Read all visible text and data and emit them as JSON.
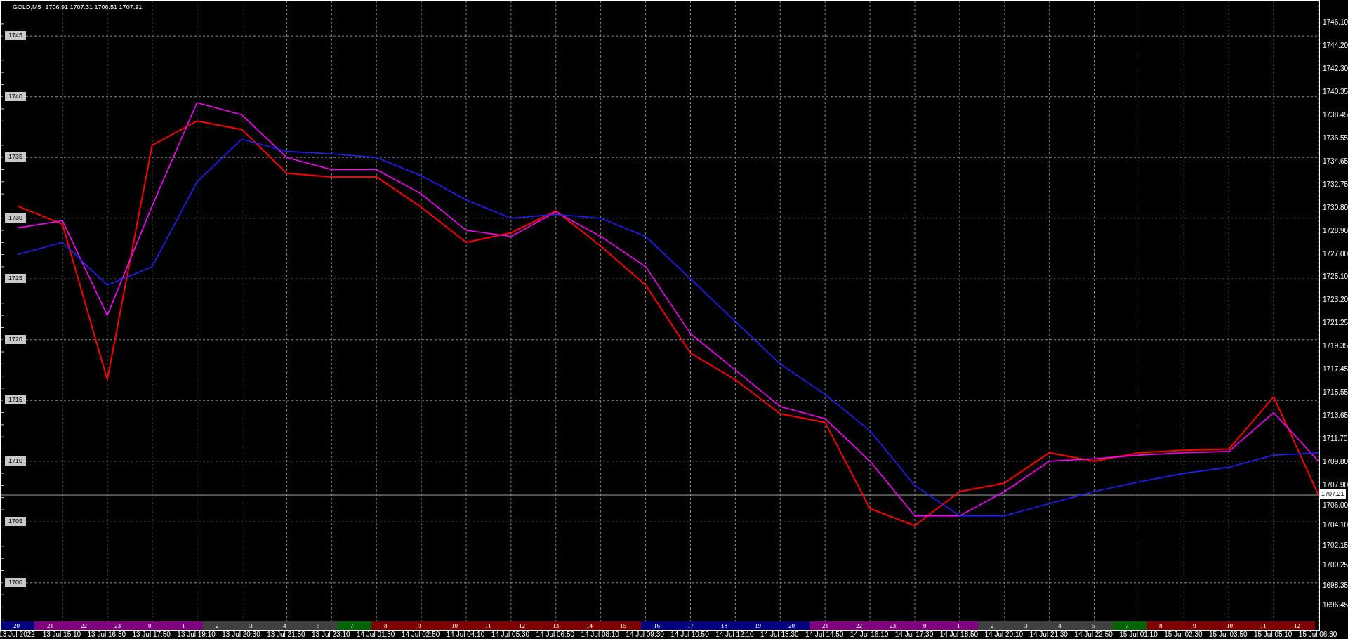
{
  "header": {
    "symbol": "GOLD,M5",
    "quote": "1706.91 1707.31 1706.51 1707.21"
  },
  "chart_data": {
    "type": "line",
    "x": [
      "13 Jul 2022",
      "13 Jul 15:10",
      "13 Jul 16:30",
      "13 Jul 17:50",
      "13 Jul 19:10",
      "13 Jul 20:30",
      "13 Jul 21:50",
      "13 Jul 23:10",
      "14 Jul 01:30",
      "14 Jul 02:50",
      "14 Jul 04:10",
      "14 Jul 05:30",
      "14 Jul 06:50",
      "14 Jul 08:10",
      "14 Jul 09:30",
      "14 Jul 10:50",
      "14 Jul 12:10",
      "14 Jul 13:30",
      "14 Jul 14:50",
      "14 Jul 16:10",
      "14 Jul 17:30",
      "14 Jul 18:50",
      "14 Jul 20:10",
      "14 Jul 21:30",
      "14 Jul 22:50",
      "15 Jul 01:10",
      "15 Jul 02:30",
      "15 Jul 03:50",
      "15 Jul 05:10",
      "15 Jul 06:30"
    ],
    "series": [
      {
        "color": "#ff0000",
        "values": [
          1731,
          1729.5,
          1716.7,
          1736,
          1738,
          1737.3,
          1733.7,
          1733.4,
          1733.4,
          1730.9,
          1728,
          1728.8,
          1730.6,
          1727.7,
          1724.5,
          1718.9,
          1716.7,
          1713.9,
          1713.2,
          1706.1,
          1704.7,
          1707.5,
          1708.2,
          1710.7,
          1710,
          1710.7,
          1710.9,
          1711,
          1715.3,
          1707.2
        ]
      },
      {
        "color": "#ff00ff",
        "values": [
          1729.2,
          1729.8,
          1722,
          1731,
          1739.5,
          1738.5,
          1735,
          1734,
          1734,
          1732,
          1729,
          1728.5,
          1730.5,
          1728.5,
          1726,
          1720.5,
          1717.5,
          1714.5,
          1713.5,
          1710,
          1705.5,
          1705.5,
          1707.5,
          1710,
          1710.2,
          1710.5,
          1710.7,
          1710.8,
          1714,
          1710
        ]
      },
      {
        "color": "#2020ff",
        "values": [
          1727,
          1728,
          1724.5,
          1726,
          1733,
          1736.5,
          1735.5,
          1735.3,
          1735,
          1733.5,
          1731.5,
          1730,
          1730.3,
          1730,
          1728.5,
          1725,
          1721.5,
          1718,
          1715.5,
          1712.5,
          1708,
          1705.5,
          1705.5,
          1706.5,
          1707.5,
          1708.3,
          1709,
          1709.5,
          1710.5,
          1710.7
        ]
      }
    ],
    "ylim": [
      1696.0,
      1747.9
    ],
    "grid": true,
    "ref_lines": [
      {
        "axis": "y",
        "value": 1707.21,
        "label": "1707.21",
        "color": "#a0a0a0"
      }
    ],
    "yticks": [
      {
        "value": 1745,
        "label": "1745"
      },
      {
        "value": 1740,
        "label": "1740"
      },
      {
        "value": 1735,
        "label": "1735"
      },
      {
        "value": 1730,
        "label": "1730"
      },
      {
        "value": 1725,
        "label": "1725"
      },
      {
        "value": 1720,
        "label": "1720"
      },
      {
        "value": 1715,
        "label": "1715"
      },
      {
        "value": 1710,
        "label": "1710"
      },
      {
        "value": 1705,
        "label": "1705"
      },
      {
        "value": 1700,
        "label": "1700"
      }
    ]
  },
  "price_scale": [
    "1746.10",
    "1744.20",
    "1742.30",
    "1740.35",
    "1738.45",
    "1736.55",
    "1734.65",
    "1732.75",
    "1730.80",
    "1728.90",
    "1727.00",
    "1725.10",
    "1723.20",
    "1721.25",
    "1719.35",
    "1717.45",
    "1715.55",
    "1713.65",
    "1711.70",
    "1709.80",
    "1707.90",
    "1706.00",
    "1704.10",
    "1702.15",
    "1700.25",
    "1698.35",
    "1696.45"
  ],
  "session_bar": [
    {
      "label": "20",
      "color": "#000080"
    },
    {
      "label": "21",
      "color": "#800080"
    },
    {
      "label": "22",
      "color": "#800080"
    },
    {
      "label": "23",
      "color": "#800080"
    },
    {
      "label": "0",
      "color": "#800080"
    },
    {
      "label": "1",
      "color": "#800080"
    },
    {
      "label": "2",
      "color": "#404040"
    },
    {
      "label": "3",
      "color": "#404040"
    },
    {
      "label": "4",
      "color": "#404040"
    },
    {
      "label": "5",
      "color": "#404040"
    },
    {
      "label": "7",
      "color": "#006400"
    },
    {
      "label": "8",
      "color": "#800000"
    },
    {
      "label": "9",
      "color": "#800000"
    },
    {
      "label": "10",
      "color": "#800000"
    },
    {
      "label": "11",
      "color": "#800000"
    },
    {
      "label": "12",
      "color": "#800000"
    },
    {
      "label": "13",
      "color": "#800000"
    },
    {
      "label": "14",
      "color": "#800000"
    },
    {
      "label": "15",
      "color": "#800000"
    },
    {
      "label": "16",
      "color": "#000080"
    },
    {
      "label": "17",
      "color": "#000080"
    },
    {
      "label": "18",
      "color": "#000080"
    },
    {
      "label": "19",
      "color": "#000080"
    },
    {
      "label": "20",
      "color": "#000080"
    },
    {
      "label": "21",
      "color": "#800080"
    },
    {
      "label": "22",
      "color": "#800080"
    },
    {
      "label": "23",
      "color": "#800080"
    },
    {
      "label": "0",
      "color": "#800080"
    },
    {
      "label": "1",
      "color": "#800080"
    },
    {
      "label": "2",
      "color": "#404040"
    },
    {
      "label": "3",
      "color": "#404040"
    },
    {
      "label": "4",
      "color": "#404040"
    },
    {
      "label": "5",
      "color": "#404040"
    },
    {
      "label": "7",
      "color": "#006400"
    },
    {
      "label": "8",
      "color": "#800000"
    },
    {
      "label": "9",
      "color": "#800000"
    },
    {
      "label": "10",
      "color": "#800000"
    },
    {
      "label": "11",
      "color": "#800000"
    },
    {
      "label": "12",
      "color": "#800000"
    }
  ]
}
